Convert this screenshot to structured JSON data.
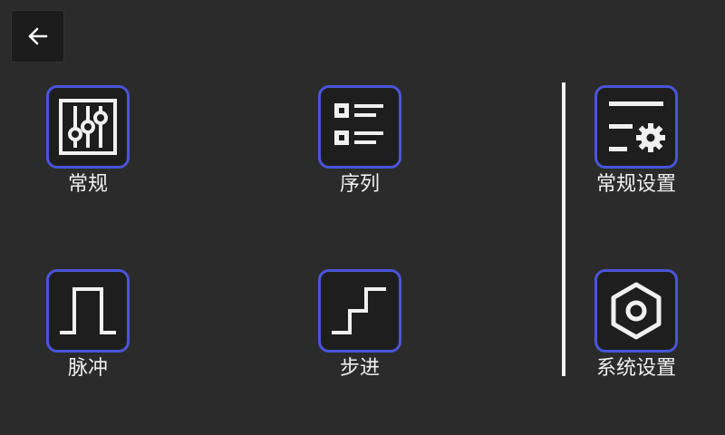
{
  "toolbar": {
    "back_icon": "arrow-left-icon"
  },
  "left_panel": {
    "items": [
      {
        "id": "general",
        "label": "常规",
        "icon": "sliders-icon"
      },
      {
        "id": "sequence",
        "label": "序列",
        "icon": "list-icon"
      },
      {
        "id": "pulse",
        "label": "脉冲",
        "icon": "pulse-wave-icon"
      },
      {
        "id": "step",
        "label": "步进",
        "icon": "staircase-icon"
      }
    ]
  },
  "right_panel": {
    "items": [
      {
        "id": "general_settings",
        "label": "常规设置",
        "icon": "settings-list-icon"
      },
      {
        "id": "system_settings",
        "label": "系统设置",
        "icon": "hexagon-nut-icon"
      }
    ]
  },
  "colors": {
    "background": "#2b2b2b",
    "tile_border": "#4a55d8",
    "tile_fill": "#1e1e1e",
    "foreground": "#f0f0f0"
  }
}
